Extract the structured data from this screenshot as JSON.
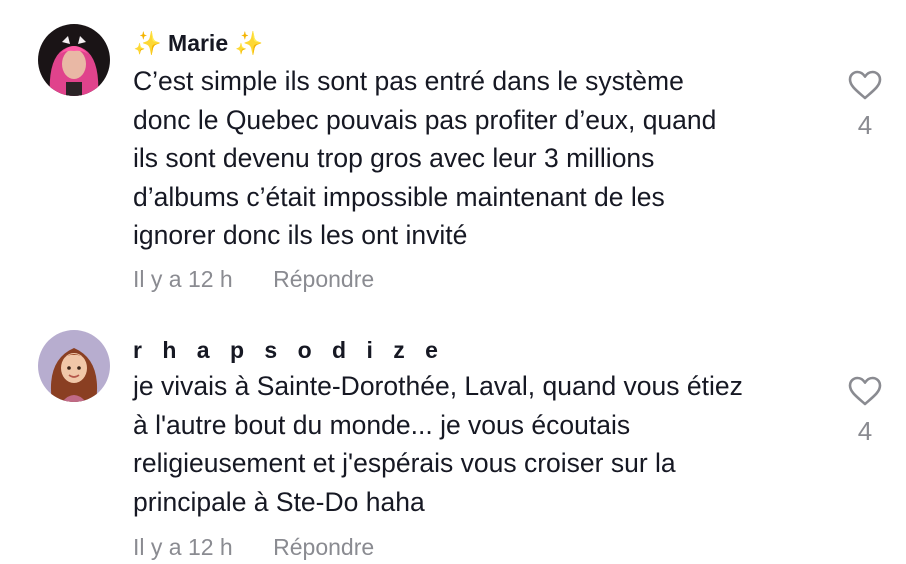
{
  "comments": [
    {
      "username": "Marie",
      "sparkle_left": "✨",
      "sparkle_right": "✨",
      "lines": [
        "C’est simple ils sont pas entré dans le système",
        "donc le Quebec pouvais pas profiter d’eux, quand",
        "ils sont devenu trop gros avec leur 3 millions",
        "d’albums c’était impossible maintenant de les",
        "ignorer donc ils les ont invité"
      ],
      "time": "Il y a 12 h",
      "reply_label": "Répondre",
      "like_count": "4",
      "like_icon": "heart-outline-icon"
    },
    {
      "username": "r h a p s o d i z e",
      "lines": [
        "je vivais à Sainte-Dorothée, Laval, quand vous étiez",
        "à l'autre bout du monde... je vous écoutais",
        "religieusement et j'espérais vous croiser sur la",
        "principale à Ste-Do haha"
      ],
      "time": "Il y a 12 h",
      "reply_label": "Répondre",
      "like_count": "4",
      "like_icon": "heart-outline-icon"
    }
  ],
  "colors": {
    "text": "#161823",
    "secondary": "#8a8b91",
    "background": "#ffffff"
  }
}
